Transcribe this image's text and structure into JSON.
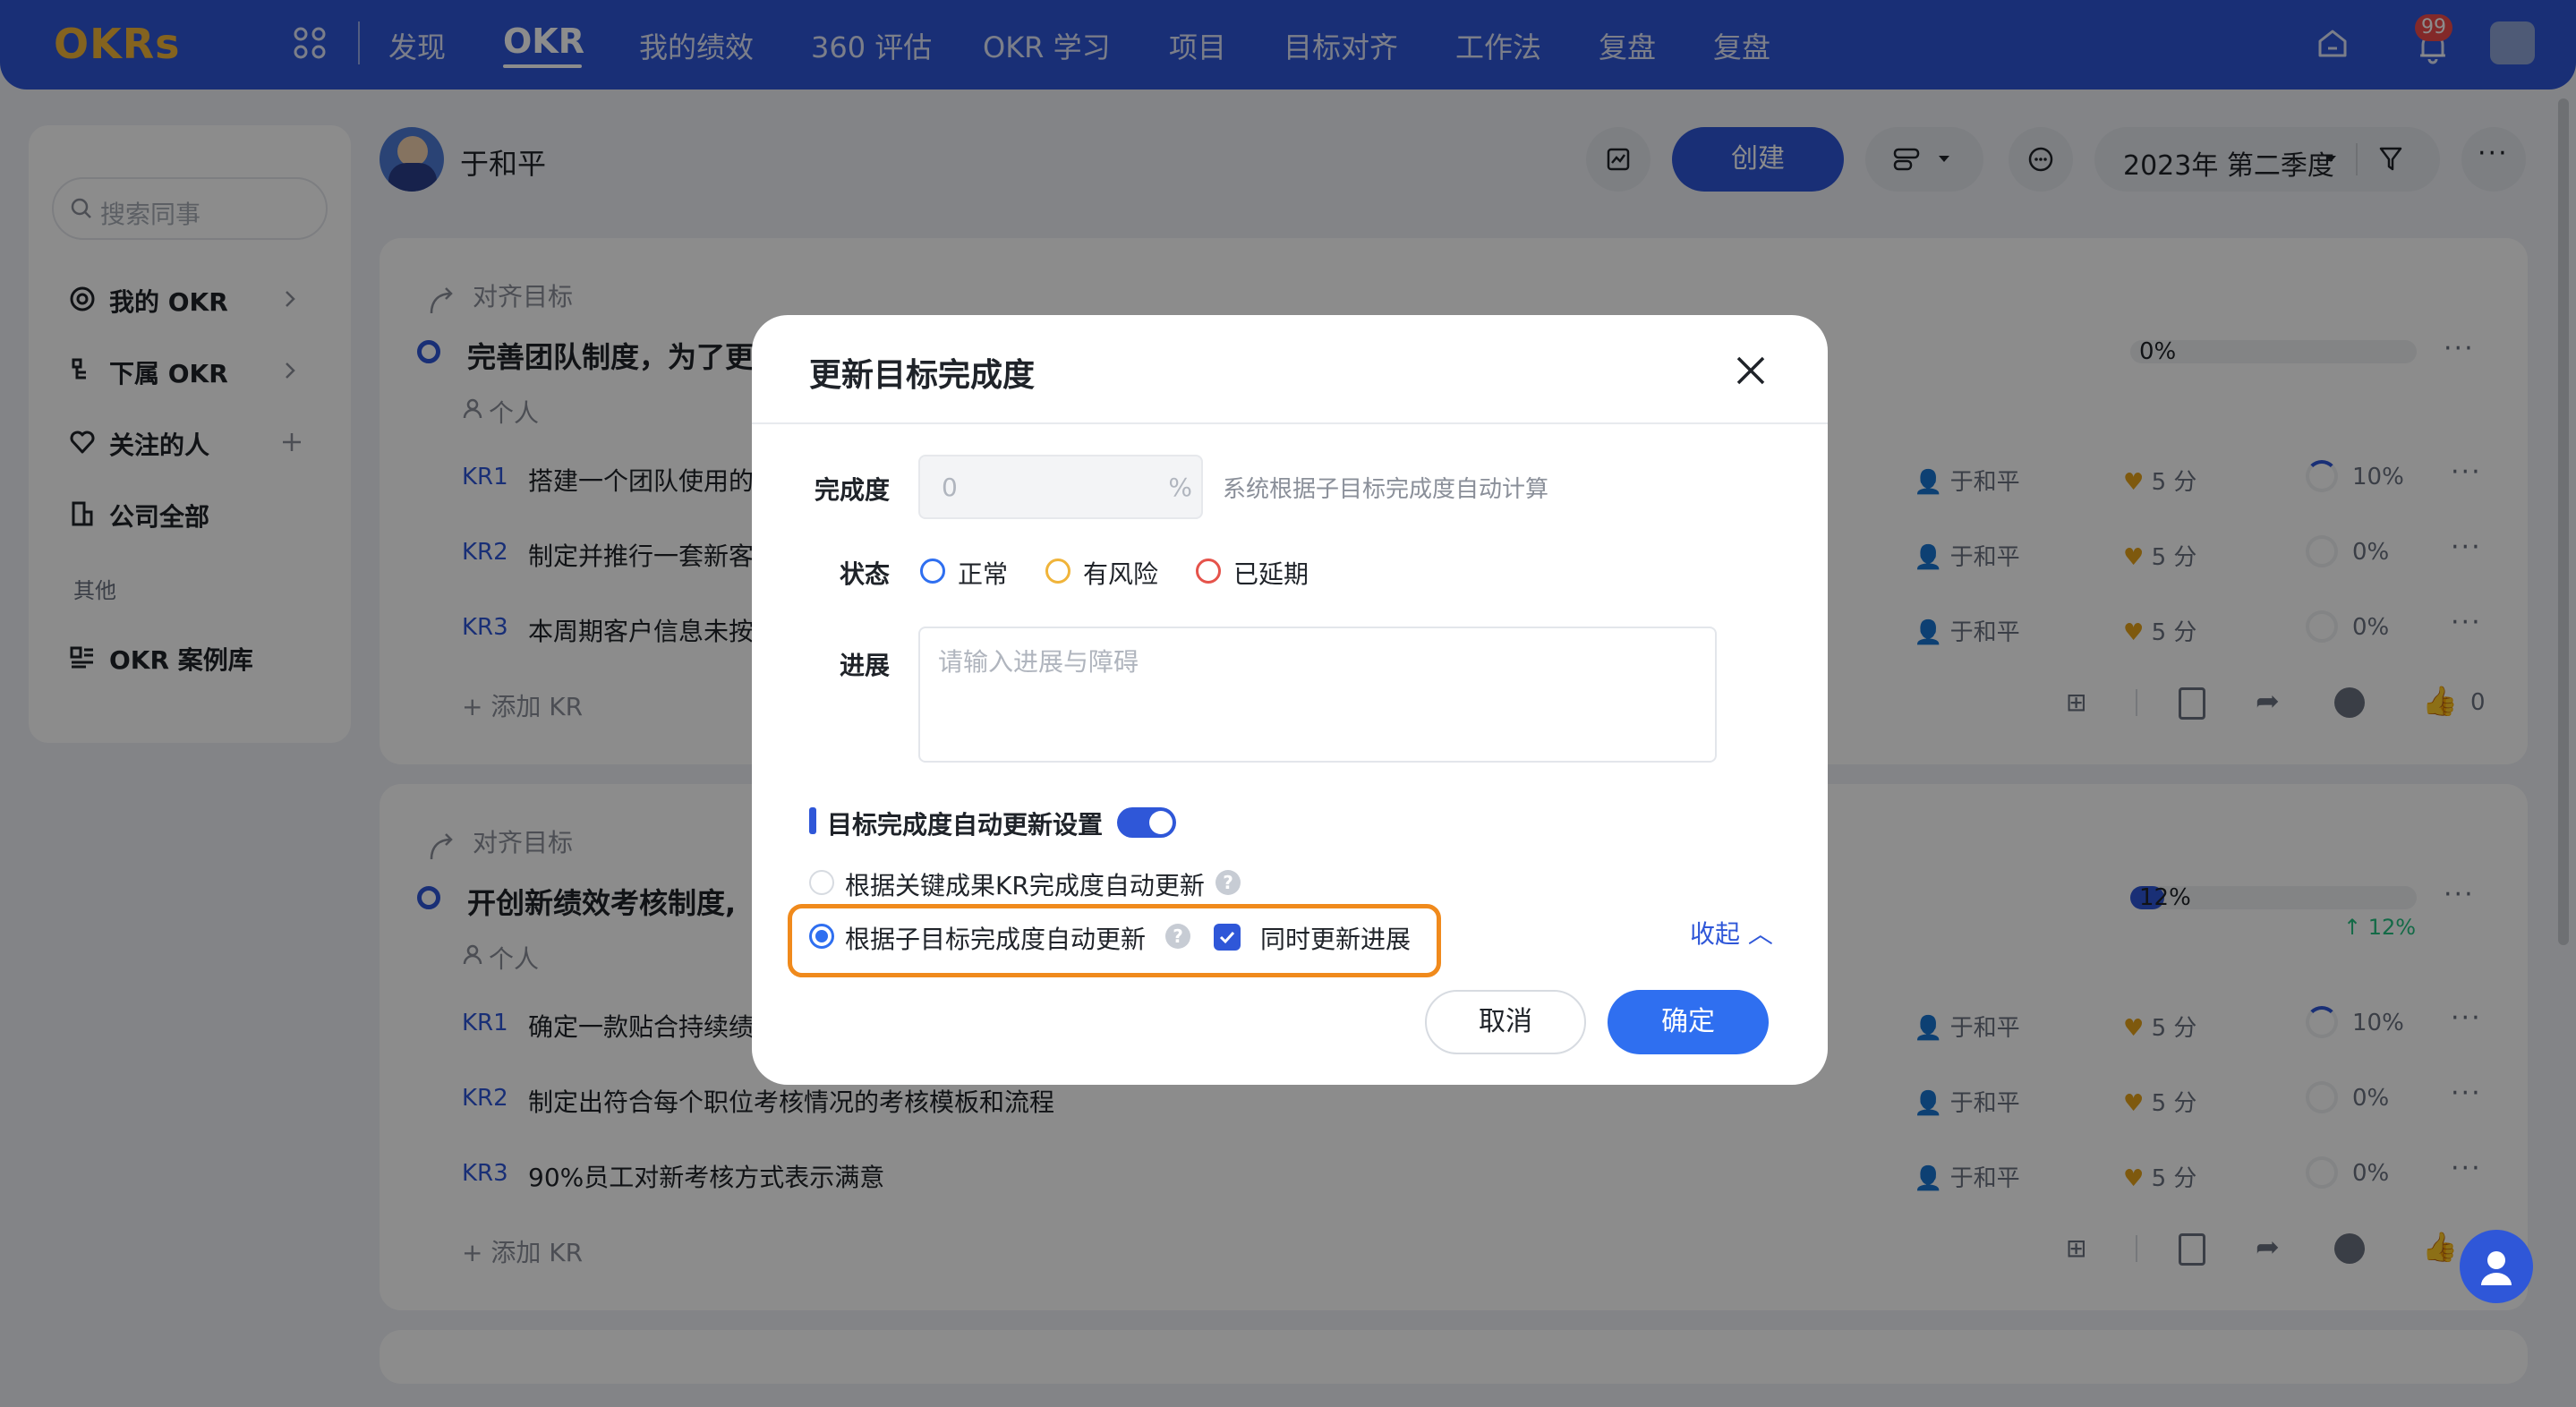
{
  "app": {
    "logo": "OKRs"
  },
  "nav": {
    "items": [
      "发现",
      "OKR",
      "我的绩效",
      "360 评估",
      "OKR 学习",
      "项目",
      "目标对齐",
      "工作法",
      "复盘",
      "复盘"
    ],
    "notifications_count": "99"
  },
  "sidebar": {
    "search_placeholder": "搜索同事",
    "items": [
      {
        "label": "我的 OKR"
      },
      {
        "label": "下属 OKR"
      },
      {
        "label": "关注的人"
      },
      {
        "label": "公司全部"
      }
    ],
    "section_label": "其他",
    "case_library": "OKR 案例库"
  },
  "header": {
    "user_name": "于和平",
    "create_label": "创建",
    "quarter": "2023年 第二季度"
  },
  "objectives": [
    {
      "align_label": "对齐目标",
      "title": "完善团队制度，为了更",
      "scope": "个人",
      "progress": "0%",
      "progress_value": 0,
      "add_kr": "添加 KR",
      "likes": "0",
      "krs": [
        {
          "tag": "KR1",
          "text": "搭建一个团队使用的",
          "owner": "于和平",
          "score": "5 分",
          "pct": "10%"
        },
        {
          "tag": "KR2",
          "text": "制定并推行一套新客",
          "owner": "于和平",
          "score": "5 分",
          "pct": "0%"
        },
        {
          "tag": "KR3",
          "text": "本周期客户信息未按",
          "owner": "于和平",
          "score": "5 分",
          "pct": "0%"
        }
      ]
    },
    {
      "align_label": "对齐目标",
      "title": "开创新绩效考核制度,",
      "scope": "个人",
      "progress": "12%",
      "progress_value": 12,
      "delta": "12%",
      "add_kr": "添加 KR",
      "krs": [
        {
          "tag": "KR1",
          "text": "确定一款贴合持续绩",
          "owner": "于和平",
          "score": "5 分",
          "pct": "10%"
        },
        {
          "tag": "KR2",
          "text": "制定出符合每个职位考核情况的考核模板和流程",
          "owner": "于和平",
          "score": "5 分",
          "pct": "0%"
        },
        {
          "tag": "KR3",
          "text": "90%员工对新考核方式表示满意",
          "owner": "于和平",
          "score": "5 分",
          "pct": "0%"
        }
      ]
    }
  ],
  "modal": {
    "title": "更新目标完成度",
    "completion_label": "完成度",
    "completion_value": "0",
    "completion_unit": "%",
    "completion_hint": "系统根据子目标完成度自动计算",
    "status_label": "状态",
    "status_options": [
      "正常",
      "有风险",
      "已延期"
    ],
    "status_colors": [
      "#2f6ff0",
      "#f0b43a",
      "#e5534b"
    ],
    "progress_label": "进展",
    "progress_placeholder": "请输入进展与障碍",
    "auto_update_title": "目标完成度自动更新设置",
    "option_kr": "根据关键成果KR完成度自动更新",
    "option_child": "根据子目标完成度自动更新",
    "sync_progress": "同时更新进展",
    "collapse": "收起",
    "cancel": "取消",
    "confirm": "确定"
  }
}
